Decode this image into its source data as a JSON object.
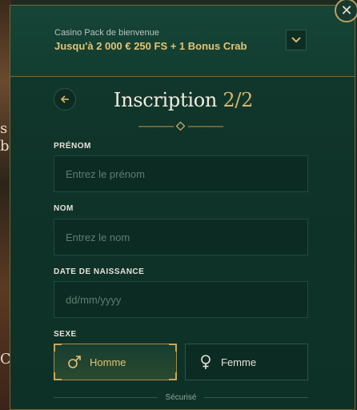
{
  "background": {
    "glyphs": [
      "s",
      "b",
      "C"
    ]
  },
  "promo": {
    "subtitle": "Casino Pack de bienvenue",
    "title": "Jusqu'à 2 000 € 250 FS + 1 Bonus Crab"
  },
  "header": {
    "title": "Inscription",
    "step": "2/2"
  },
  "form": {
    "firstname": {
      "label": "PRÉNOM",
      "placeholder": "Entrez le prénom",
      "value": ""
    },
    "lastname": {
      "label": "NOM",
      "placeholder": "Entrez le nom",
      "value": ""
    },
    "birthdate": {
      "label": "DATE DE NAISSANCE",
      "placeholder": "dd/mm/yyyy",
      "value": ""
    },
    "gender": {
      "label": "SEXE",
      "options": [
        {
          "label": "Homme",
          "icon": "male-icon",
          "selected": true
        },
        {
          "label": "Femme",
          "icon": "female-icon",
          "selected": false
        }
      ]
    }
  },
  "footer": {
    "secure_label": "Sécurisé"
  },
  "colors": {
    "accent_gold": "#d6b56a",
    "modal_bg": "#0f3329",
    "field_bg": "#0c2c23"
  }
}
